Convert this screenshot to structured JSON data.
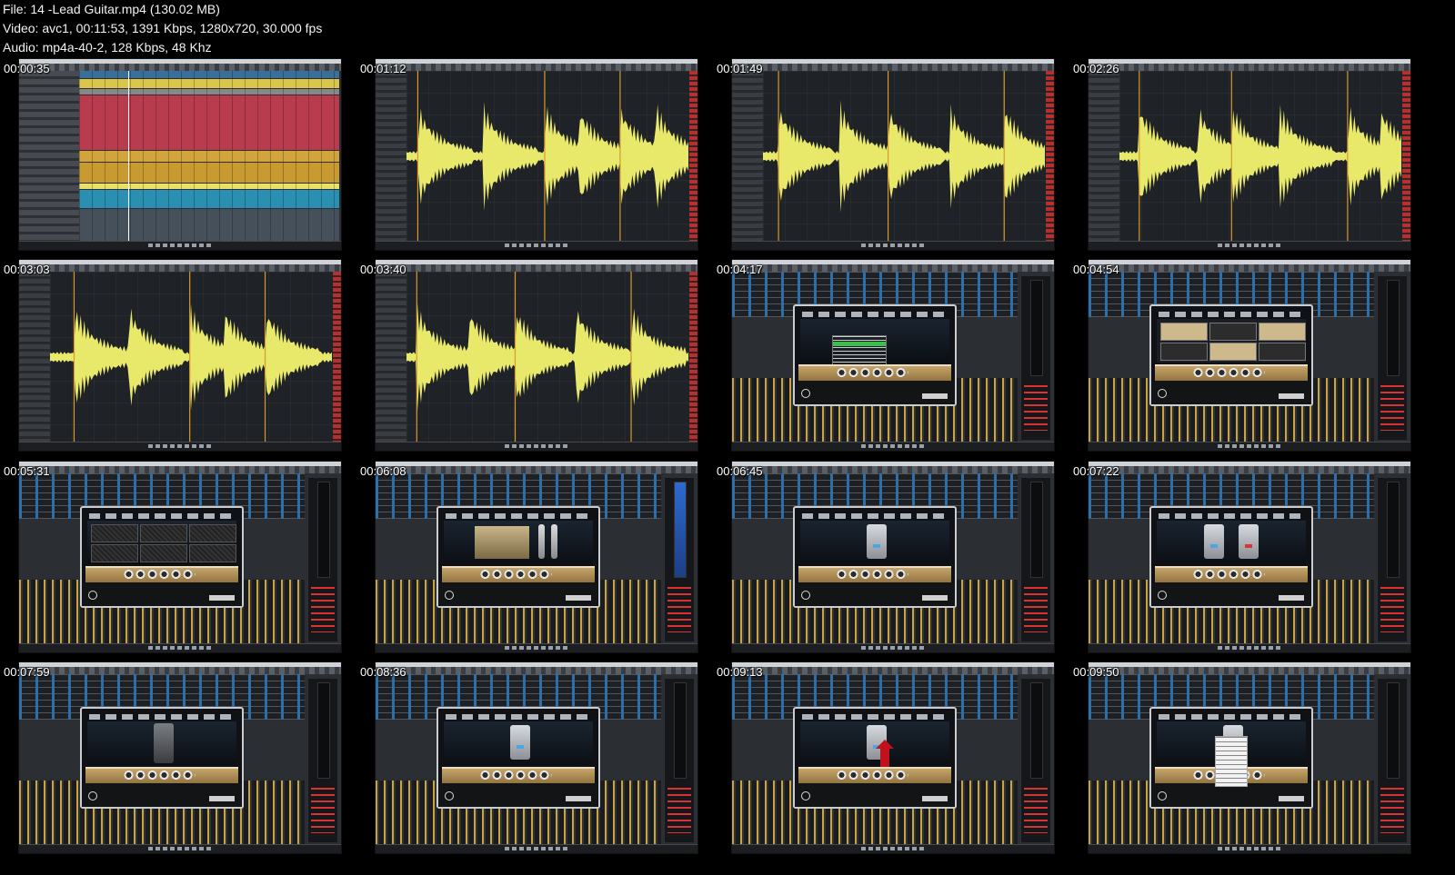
{
  "header": {
    "file_line": "File: 14 -Lead Guitar.mp4 (130.02 MB)",
    "video_line": "Video: avc1, 00:11:53, 1391 Kbps, 1280x720, 30.000 fps",
    "audio_line": "Audio: mp4a-40-2, 128 Kbps, 48 Khz"
  },
  "thumbnails": [
    {
      "time": "00:00:35",
      "view": "project"
    },
    {
      "time": "00:01:12",
      "view": "waveform"
    },
    {
      "time": "00:01:49",
      "view": "waveform"
    },
    {
      "time": "00:02:26",
      "view": "waveform"
    },
    {
      "time": "00:03:03",
      "view": "waveform"
    },
    {
      "time": "00:03:40",
      "view": "waveform"
    },
    {
      "time": "00:04:17",
      "view": "mixer-preset-list"
    },
    {
      "time": "00:04:54",
      "view": "mixer-amp-select"
    },
    {
      "time": "00:05:31",
      "view": "mixer-cabinet"
    },
    {
      "time": "00:06:08",
      "view": "mixer-mics"
    },
    {
      "time": "00:06:45",
      "view": "mixer-pedal"
    },
    {
      "time": "00:07:22",
      "view": "mixer-pedals"
    },
    {
      "time": "00:07:59",
      "view": "mixer-pedal-slot"
    },
    {
      "time": "00:08:36",
      "view": "mixer-pedal"
    },
    {
      "time": "00:09:13",
      "view": "mixer-pedal-arrow"
    },
    {
      "time": "00:09:50",
      "view": "mixer-pedal-menu"
    }
  ],
  "colors": {
    "waveform": "#e8e86a",
    "marker": "#d99a2b",
    "preset_selected": "#3cbf4a"
  }
}
